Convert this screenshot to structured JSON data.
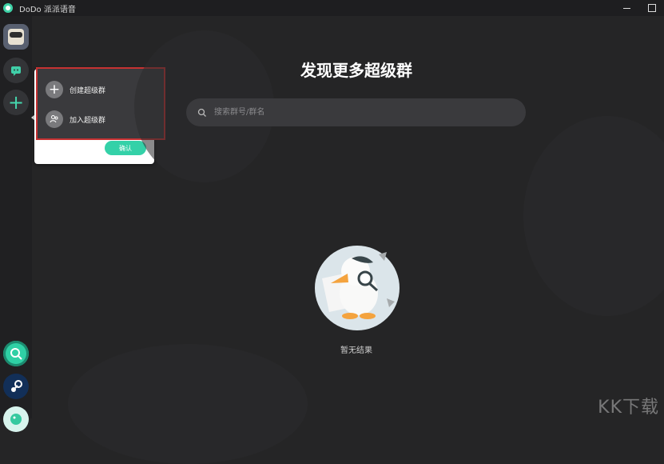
{
  "window": {
    "title": "DoDo 派派语音"
  },
  "popup": {
    "items": [
      {
        "label": "创建超级群",
        "icon": "plus-icon"
      },
      {
        "label": "加入超级群",
        "icon": "group-icon"
      }
    ],
    "confirm": "确认"
  },
  "main": {
    "title": "发现更多超级群",
    "search_placeholder": "搜索群号/群名",
    "empty_text": "暂无结果"
  },
  "watermark": "KK下载",
  "colors": {
    "accent": "#34d1a8",
    "background": "#252526",
    "highlight": "#c53232"
  }
}
